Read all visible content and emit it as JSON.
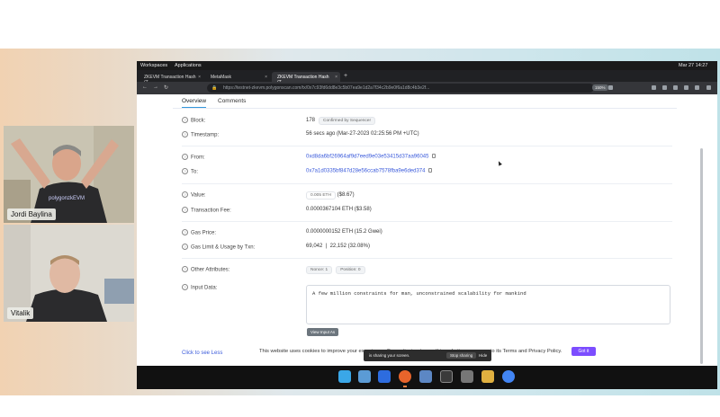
{
  "participants": [
    {
      "name": "Jordi Baylina"
    },
    {
      "name": "Vitalik"
    }
  ],
  "os_topbar": {
    "workspaces": "Workspaces",
    "applications": "Applications",
    "datetime": "Mar 27  14:27"
  },
  "browser": {
    "tabs": [
      {
        "label": "ZKEVM Transaction Hash (T...",
        "active": false
      },
      {
        "label": "MetaMask",
        "active": false
      },
      {
        "label": "ZKEVM Transaction Hash (T...",
        "active": true
      }
    ],
    "url": "https://testnet-zkevm.polygonscan.com/tx/0x7c93fd6dd8e3c5b07ea9e1d2a7f34c2b9e0f6a1d8c4b3e2f...",
    "zoom": "150%"
  },
  "explorer": {
    "tabs": [
      "Overview",
      "Comments"
    ],
    "rows": {
      "block_label": "Block:",
      "block_value": "178",
      "block_pill": "Confirmed by Sequencer",
      "timestamp_label": "Timestamp:",
      "timestamp_value": "56 secs ago (Mar-27-2023 02:25:56 PM +UTC)",
      "from_label": "From:",
      "from_value": "0xd8da6bf26964af9d7eed9e03e53415d37aa96045",
      "to_label": "To:",
      "to_value": "0x7a1d0335bf847d28e56ccab7578fba9e6ded374",
      "value_label": "Value:",
      "value_value": "0.005 ETH",
      "value_usd": "($8.67)",
      "fee_label": "Transaction Fee:",
      "fee_value": "0.0000367104 ETH ($3.58)",
      "gasprice_label": "Gas Price:",
      "gasprice_value": "0.0000000152 ETH (15.2 Gwei)",
      "gaslimit_label": "Gas Limit & Usage by Txn:",
      "gaslimit_value": "69,042",
      "gaslimit_usage": "22,152 (32.08%)",
      "other_label": "Other Attributes:",
      "nonce_label": "Nonce: 1",
      "position_label": "Position: 0",
      "input_label": "Input Data:",
      "input_value": "A few million constraints for man, unconstrained scalability for mankind",
      "view_input": "View Input As"
    },
    "click_lens": "Click to see Less",
    "cookie_text": "This website uses cookies to improve your experience. By continuing to use this website, you agree to its Terms and Privacy Policy.",
    "cookie_ok": "Got it",
    "share_text": "is sharing your screen.",
    "share_stop": "Stop sharing",
    "share_hide": "Hide"
  }
}
